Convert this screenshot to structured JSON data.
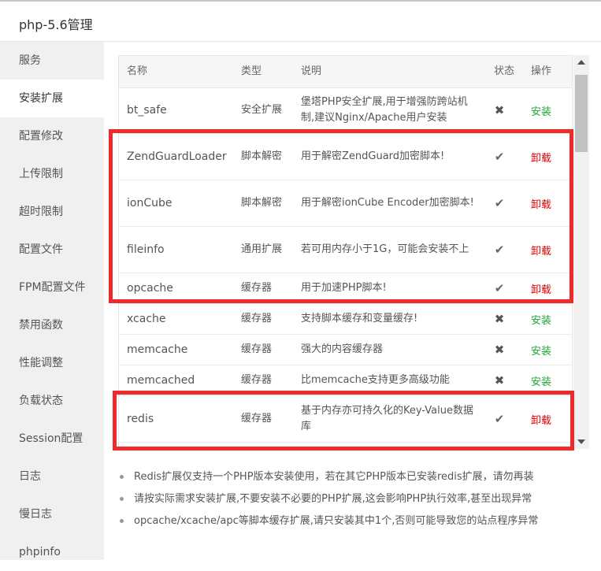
{
  "window": {
    "title": "php-5.6管理"
  },
  "sidebar": {
    "items": [
      {
        "label": "服务"
      },
      {
        "label": "安装扩展",
        "active": true
      },
      {
        "label": "配置修改"
      },
      {
        "label": "上传限制"
      },
      {
        "label": "超时限制"
      },
      {
        "label": "配置文件"
      },
      {
        "label": "FPM配置文件"
      },
      {
        "label": "禁用函数"
      },
      {
        "label": "性能调整"
      },
      {
        "label": "负载状态"
      },
      {
        "label": "Session配置"
      },
      {
        "label": "日志"
      },
      {
        "label": "慢日志"
      },
      {
        "label": "phpinfo"
      }
    ]
  },
  "table": {
    "headers": {
      "name": "名称",
      "type": "类型",
      "desc": "说明",
      "status": "状态",
      "op": "操作"
    },
    "rows": [
      {
        "name": "bt_safe",
        "type": "安全扩展",
        "desc": "堡塔PHP安全扩展,用于增强防跨站机制,建议Nginx/Apache用户安装",
        "status_icon": "x-icon",
        "status": "not-installed",
        "op": "安装"
      },
      {
        "name": "ZendGuardLoader",
        "type": "脚本解密",
        "desc": "用于解密ZendGuard加密脚本!",
        "status_icon": "check-icon",
        "status": "installed",
        "op": "卸载"
      },
      {
        "name": "ionCube",
        "type": "脚本解密",
        "desc": "用于解密ionCube Encoder加密脚本!",
        "status_icon": "check-icon",
        "status": "installed",
        "op": "卸载"
      },
      {
        "name": "fileinfo",
        "type": "通用扩展",
        "desc": "若可用内存小于1G，可能会安装不上",
        "status_icon": "check-icon",
        "status": "installed",
        "op": "卸载"
      },
      {
        "name": "opcache",
        "type": "缓存器",
        "desc": "用于加速PHP脚本!",
        "status_icon": "check-icon",
        "status": "installed",
        "op": "卸载"
      },
      {
        "name": "xcache",
        "type": "缓存器",
        "desc": "支持脚本缓存和变量缓存!",
        "status_icon": "x-icon",
        "status": "not-installed",
        "op": "安装"
      },
      {
        "name": "memcache",
        "type": "缓存器",
        "desc": "强大的内容缓存器",
        "status_icon": "x-icon",
        "status": "not-installed",
        "op": "安装"
      },
      {
        "name": "memcached",
        "type": "缓存器",
        "desc": "比memcache支持更多高级功能",
        "status_icon": "x-icon",
        "status": "not-installed",
        "op": "安装"
      },
      {
        "name": "redis",
        "type": "缓存器",
        "desc": "基于内存亦可持久化的Key-Value数据库",
        "status_icon": "check-icon",
        "status": "installed",
        "op": "卸载"
      }
    ]
  },
  "notes": [
    "Redis扩展仅支持一个PHP版本安装使用，若在其它PHP版本已安装redis扩展，请勿再装",
    "请按实际需求安装扩展,不要安装不必要的PHP扩展,这会影响PHP执行效率,甚至出现异常",
    "opcache/xcache/apc等脚本缓存扩展,请只安装其中1个,否则可能导致您的站点程序异常"
  ],
  "colors": {
    "install": "#20a53a",
    "uninstall": "#e00000",
    "highlight": "#ee2a2a",
    "sidebar_bg": "#f0f0f0"
  }
}
